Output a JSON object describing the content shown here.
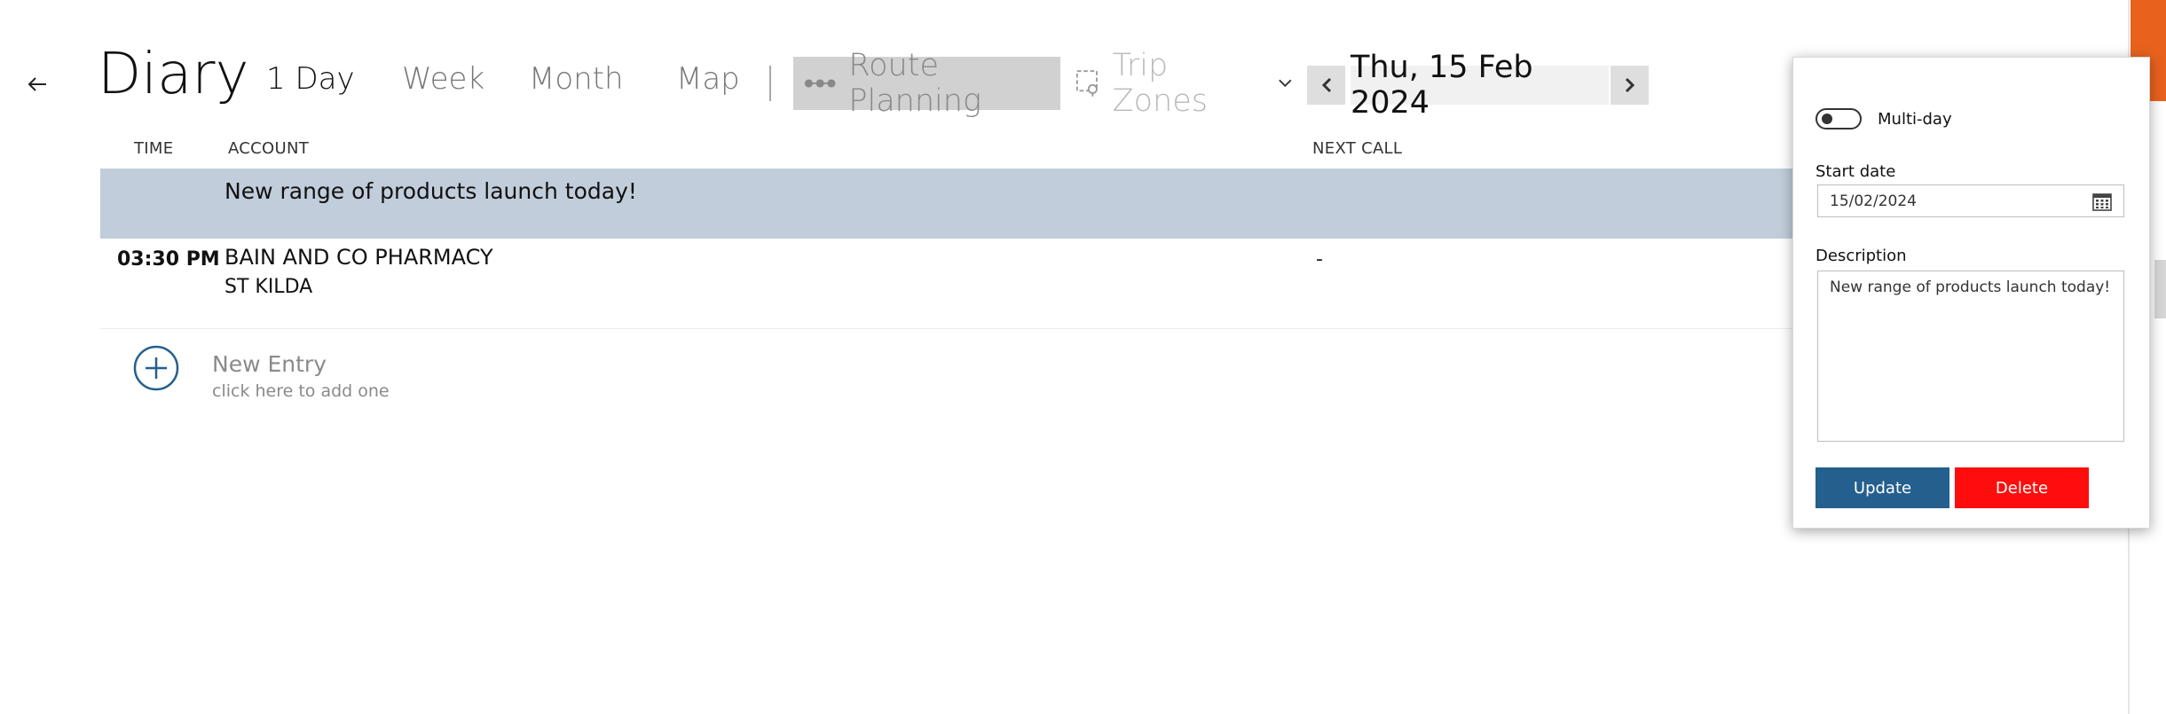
{
  "header": {
    "title": "Diary",
    "views": [
      "1 Day",
      "Week",
      "Month",
      "Map"
    ],
    "active_view": "1 Day",
    "route_planning": "Route Planning",
    "trip_zones": "Trip Zones",
    "current_date": "Thu, 15 Feb 2024"
  },
  "table": {
    "columns": {
      "time": "TIME",
      "account": "ACCOUNT",
      "next_call": "NEXT CALL"
    },
    "highlight_note": "New range of products launch today!",
    "entries": [
      {
        "time": "03:30 PM",
        "account": "BAIN AND CO PHARMACY",
        "suburb": "ST KILDA",
        "next_call": "-"
      }
    ]
  },
  "new_entry": {
    "title": "New Entry",
    "hint": "click here to add one"
  },
  "panel": {
    "multiday_label": "Multi-day",
    "multiday_on": false,
    "start_date_label": "Start date",
    "start_date_value": "15/02/2024",
    "description_label": "Description",
    "description_value": "New range of products launch today!",
    "update_label": "Update",
    "delete_label": "Delete"
  },
  "colors": {
    "highlight_row": "#c1cdda",
    "update_button": "#245f8e",
    "delete_button": "#ff0d0d",
    "accent": "#e8621e",
    "icon_blue": "#245f8e"
  }
}
